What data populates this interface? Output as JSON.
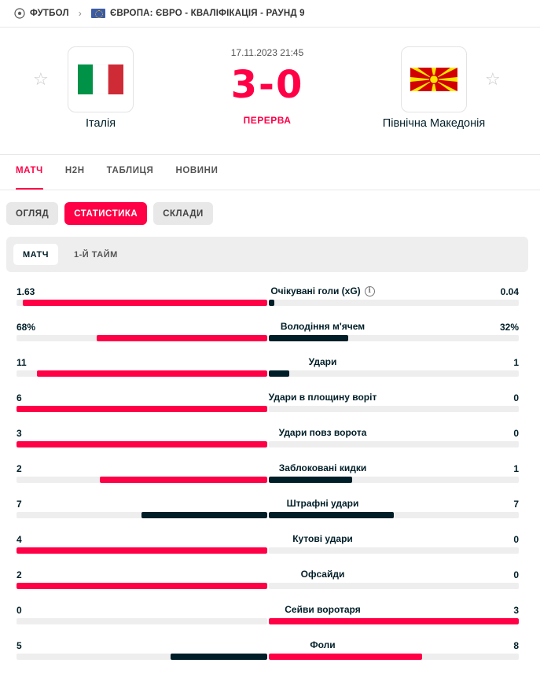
{
  "breadcrumb": {
    "sport": "ФУТБОЛ",
    "competition": "ЄВРОПА: ЄВРО - КВАЛІФІКАЦІЯ - РАУНД 9"
  },
  "match": {
    "datetime": "17.11.2023 21:45",
    "score_home": "3",
    "score_separator": "-",
    "score_away": "0",
    "status": "ПЕРЕРВА",
    "home_team": "Італія",
    "away_team": "Північна Македонія"
  },
  "tabs": [
    "МАТЧ",
    "H2H",
    "ТАБЛИЦЯ",
    "НОВИНИ"
  ],
  "pills": [
    "ОГЛЯД",
    "СТАТИСТИКА",
    "СКЛАДИ"
  ],
  "subtabs": [
    "МАТЧ",
    "1-Й ТАЙМ"
  ],
  "colors": {
    "accent": "#ff0046",
    "dark": "#001e28",
    "track": "#eeeeee"
  },
  "stats": [
    {
      "label": "Очікувані голи (xG)",
      "home": "1.63",
      "away": "0.04",
      "home_frac": 0.976,
      "away_frac": 0.024,
      "info": true
    },
    {
      "label": "Володіння м'ячем",
      "home": "68%",
      "away": "32%",
      "home_frac": 0.68,
      "away_frac": 0.32,
      "info": false
    },
    {
      "label": "Удари",
      "home": "11",
      "away": "1",
      "home_frac": 0.917,
      "away_frac": 0.083,
      "info": false
    },
    {
      "label": "Удари в площину воріт",
      "home": "6",
      "away": "0",
      "home_frac": 1.0,
      "away_frac": 0.0,
      "info": false
    },
    {
      "label": "Удари повз ворота",
      "home": "3",
      "away": "0",
      "home_frac": 1.0,
      "away_frac": 0.0,
      "info": false
    },
    {
      "label": "Заблоковані кидки",
      "home": "2",
      "away": "1",
      "home_frac": 0.667,
      "away_frac": 0.333,
      "info": false
    },
    {
      "label": "Штрафні удари",
      "home": "7",
      "away": "7",
      "home_frac": 0.5,
      "away_frac": 0.5,
      "info": false
    },
    {
      "label": "Кутові удари",
      "home": "4",
      "away": "0",
      "home_frac": 1.0,
      "away_frac": 0.0,
      "info": false
    },
    {
      "label": "Офсайди",
      "home": "2",
      "away": "0",
      "home_frac": 1.0,
      "away_frac": 0.0,
      "info": false
    },
    {
      "label": "Сейви воротаря",
      "home": "0",
      "away": "3",
      "home_frac": 0.0,
      "away_frac": 1.0,
      "info": false
    },
    {
      "label": "Фоли",
      "home": "5",
      "away": "8",
      "home_frac": 0.385,
      "away_frac": 0.615,
      "info": false
    }
  ]
}
